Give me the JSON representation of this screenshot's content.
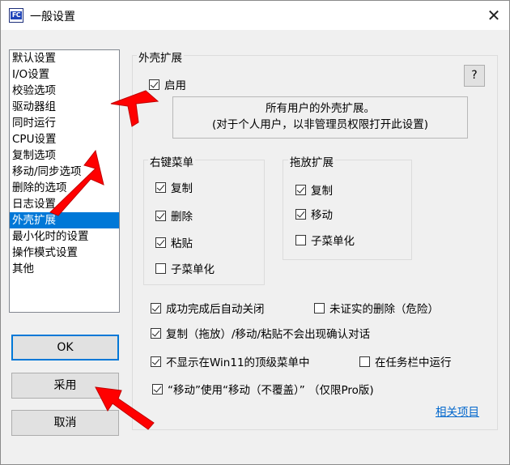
{
  "window": {
    "icon_text": "FC",
    "title": "一般设置",
    "close": "✕"
  },
  "nav": {
    "items": [
      {
        "label": "默认设置",
        "selected": false
      },
      {
        "label": "I/O设置",
        "selected": false
      },
      {
        "label": "校验选项",
        "selected": false
      },
      {
        "label": "驱动器组",
        "selected": false
      },
      {
        "label": "同时运行",
        "selected": false
      },
      {
        "label": "CPU设置",
        "selected": false
      },
      {
        "label": "复制选项",
        "selected": false
      },
      {
        "label": "移动/同步选项",
        "selected": false
      },
      {
        "label": "删除的选项",
        "selected": false
      },
      {
        "label": "日志设置",
        "selected": false
      },
      {
        "label": "外壳扩展",
        "selected": true
      },
      {
        "label": "最小化时的设置",
        "selected": false
      },
      {
        "label": "操作模式设置",
        "selected": false
      },
      {
        "label": "其他",
        "selected": false
      }
    ]
  },
  "buttons": {
    "ok": "OK",
    "apply": "采用",
    "cancel": "取消"
  },
  "shell": {
    "group_title": "外壳扩展",
    "help": "?",
    "enable_label": "启用",
    "enable_checked": true,
    "info_line1": "所有用户的外壳扩展。",
    "info_line2": "(对于个人用户，以非管理员权限打开此设置)"
  },
  "context_menu": {
    "title": "右键菜单",
    "items": [
      {
        "label": "复制",
        "checked": true
      },
      {
        "label": "删除",
        "checked": true
      },
      {
        "label": "粘贴",
        "checked": true
      },
      {
        "label": "子菜单化",
        "checked": false
      }
    ]
  },
  "drag_ext": {
    "title": "拖放扩展",
    "items": [
      {
        "label": "复制",
        "checked": true
      },
      {
        "label": "移动",
        "checked": true
      },
      {
        "label": "子菜单化",
        "checked": false
      }
    ]
  },
  "options": {
    "auto_close": {
      "label": "成功完成后自动关闭",
      "checked": true
    },
    "unverified_delete": {
      "label": "未证实的删除（危险）",
      "checked": false
    },
    "no_confirm": {
      "label": "复制（拖放）/移动/粘贴不会出现确认对话",
      "checked": true
    },
    "no_top_menu": {
      "label": "不显示在Win11的顶级菜单中",
      "checked": true
    },
    "taskbar": {
      "label": "在任务栏中运行",
      "checked": false
    },
    "move_no_overwrite": {
      "label": "“移动”使用“移动（不覆盖）” （仅限Pro版)",
      "checked": true
    }
  },
  "link": "相关项目",
  "colors": {
    "accent": "#0078d7",
    "annotation_arrow": "#ff0000",
    "link": "#0066cc"
  }
}
